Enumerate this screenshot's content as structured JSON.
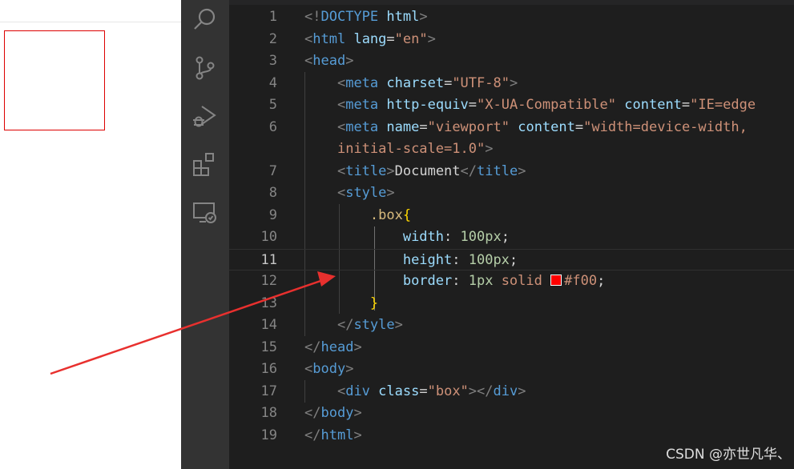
{
  "activity_bar": {
    "icons": [
      "search-icon",
      "source-control-icon",
      "run-debug-icon",
      "extensions-icon",
      "remote-explorer-icon"
    ]
  },
  "editor": {
    "current_line": 11,
    "lines": [
      {
        "n": "1"
      },
      {
        "n": "2"
      },
      {
        "n": "3"
      },
      {
        "n": "4"
      },
      {
        "n": "5"
      },
      {
        "n": "6"
      },
      {
        "n": ""
      },
      {
        "n": "7"
      },
      {
        "n": "8"
      },
      {
        "n": "9"
      },
      {
        "n": "10"
      },
      {
        "n": "11"
      },
      {
        "n": "12"
      },
      {
        "n": "13"
      },
      {
        "n": "14"
      },
      {
        "n": "15"
      },
      {
        "n": "16"
      },
      {
        "n": "17"
      },
      {
        "n": "18"
      },
      {
        "n": "19"
      }
    ],
    "code": {
      "l1": {
        "open": "<!",
        "kw": "DOCTYPE",
        "name": "html",
        "close": ">"
      },
      "l2": {
        "lt": "<",
        "tag": "html",
        "attr": "lang",
        "eq": "=",
        "val": "\"en\"",
        "gt": ">"
      },
      "l3": {
        "lt": "<",
        "tag": "head",
        "gt": ">"
      },
      "l4": {
        "lt": "<",
        "tag": "meta",
        "attr": "charset",
        "eq": "=",
        "val": "\"UTF-8\"",
        "gt": ">"
      },
      "l5": {
        "lt": "<",
        "tag": "meta",
        "attr1": "http-equiv",
        "eq": "=",
        "val1": "\"X-UA-Compatible\"",
        "attr2": "content",
        "val2": "\"IE=edge"
      },
      "l6": {
        "lt": "<",
        "tag": "meta",
        "attr1": "name",
        "eq": "=",
        "val1": "\"viewport\"",
        "attr2": "content",
        "val2": "\"width=device-width,"
      },
      "l6b": {
        "val": "initial-scale=1.0\"",
        "gt": ">"
      },
      "l7": {
        "lt": "<",
        "tag": "title",
        "gt": ">",
        "text": "Document",
        "lt2": "</",
        "tag2": "title",
        "gt2": ">"
      },
      "l8": {
        "lt": "<",
        "tag": "style",
        "gt": ">"
      },
      "l9": {
        "selector": ".box",
        "brace": "{"
      },
      "l10": {
        "prop": "width",
        "colon": ": ",
        "val": "100px",
        "semi": ";"
      },
      "l11": {
        "prop": "height",
        "colon": ": ",
        "val": "100px",
        "semi": ";"
      },
      "l12": {
        "prop": "border",
        "colon": ": ",
        "num": "1px",
        "kw": " solid ",
        "color": "#f00",
        "semi": ";"
      },
      "l13": {
        "brace": "}"
      },
      "l14": {
        "lt": "</",
        "tag": "style",
        "gt": ">"
      },
      "l15": {
        "lt": "</",
        "tag": "head",
        "gt": ">"
      },
      "l16": {
        "lt": "<",
        "tag": "body",
        "gt": ">"
      },
      "l17": {
        "lt": "<",
        "tag": "div",
        "attr": "class",
        "eq": "=",
        "val": "\"box\"",
        "gt": ">",
        "lt2": "</",
        "tag2": "div",
        "gt2": ">"
      },
      "l18": {
        "lt": "</",
        "tag": "body",
        "gt": ">"
      },
      "l19": {
        "lt": "</",
        "tag": "html",
        "gt": ">"
      }
    }
  },
  "watermark": "CSDN @亦世凡华、",
  "colors": {
    "editor_bg": "#1e1e1e",
    "activity_bg": "#333333",
    "arrow": "#e8302e",
    "box_border": "#dd0000"
  }
}
